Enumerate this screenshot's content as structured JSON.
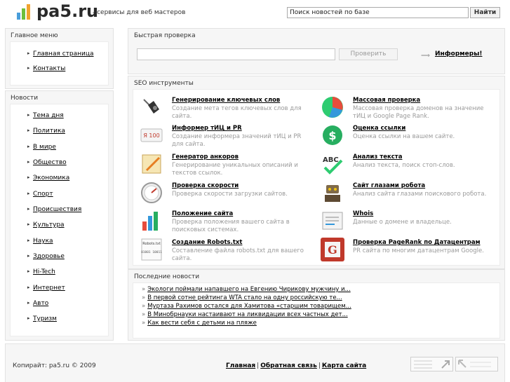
{
  "header": {
    "logo_text": "pa5.ru",
    "tagline": "- сервисы для веб мастеров",
    "search_value": "Поиск новостей по базе",
    "search_button": "Найти"
  },
  "main_menu": {
    "title": "Главное меню",
    "items": [
      "Главная страница",
      "Контакты"
    ]
  },
  "news_menu": {
    "title": "Новости",
    "items": [
      "Тема дня",
      "Политика",
      "В мире",
      "Общество",
      "Экономика",
      "Спорт",
      "Происшествия",
      "Культура",
      "Наука",
      "Здоровье",
      "Hi-Tech",
      "Интернет",
      "Авто",
      "Туризм"
    ]
  },
  "quick_check": {
    "title": "Быстрая проверка",
    "input_value": "",
    "button": "Проверить",
    "informers_link": "Информеры!"
  },
  "seo": {
    "title": "SEO инструменты",
    "tools": [
      {
        "title": "Генерирование ключевых слов",
        "desc": "Создание мета тегов ключевых слов для сайта.",
        "icon": "pushpin-icon"
      },
      {
        "title": "Массовая проверка",
        "desc": "Массовая проверка доменов на значение тИЦ и Google Page Rank.",
        "icon": "pie-chart-icon"
      },
      {
        "title": "Информер тИЦ и PR",
        "desc": "Создание информера значений тИЦ и PR для сайта.",
        "icon": "informer-badge-icon"
      },
      {
        "title": "Оценка ссылки",
        "desc": "Оценка ссылки на вашем сайте.",
        "icon": "dollar-icon"
      },
      {
        "title": "Генератор анкоров",
        "desc": "Генерирование уникальных описаний и текстов ссылок.",
        "icon": "notepad-pencil-icon"
      },
      {
        "title": "Анализ текста",
        "desc": "Анализ текста, поиск стоп-слов.",
        "icon": "abc-check-icon"
      },
      {
        "title": "Проверка скорости",
        "desc": "Проверка скорости загрузки сайтов.",
        "icon": "speedometer-icon"
      },
      {
        "title": "Сайт глазами робота",
        "desc": "Анализ сайта глазами поискового робота.",
        "icon": "robot-icon"
      },
      {
        "title": "Положение сайта",
        "desc": "Проверка положения вашего сайта в поисковых системах.",
        "icon": "bar-chart-icon"
      },
      {
        "title": "Whois",
        "desc": "Данные о домене и владельце.",
        "icon": "whois-card-icon"
      },
      {
        "title": "Создание Robots.txt",
        "desc": "Составление файла robots.txt для вашего сайта.",
        "icon": "robots-file-icon"
      },
      {
        "title": "Проверка PageRank по Датацентрам",
        "desc": "PR сайта по многим датацентрам Google.",
        "icon": "google-icon"
      }
    ],
    "icon_texts": {
      "informer": "Я 100",
      "abc": "ABC",
      "robots": "Robots.txt",
      "binary": "01001 10011",
      "google": "G"
    }
  },
  "latest_news": {
    "title": "Последние новости",
    "items": [
      "Экологи поймали напавшего на Евгению Чирикову мужчину и...",
      "В первой сотне рейтинга WTA стало на одну российскую те...",
      "Муртаза Рахимов остался для Хамитова «старшим товарищем...",
      "В Минобрнауки настаивают на ликвидации всех частных дет...",
      "Как вести себя с детьми на пляже"
    ]
  },
  "footer": {
    "copyright": "Копирайт: pa5.ru © 2009",
    "links": [
      "Главная",
      "Обратная связь",
      "Карта сайта"
    ],
    "separator": "|"
  },
  "colors": {
    "panel_bg": "#f6f6f6",
    "logo_bars": [
      "#4caf50",
      "#2196f3",
      "#f39c12",
      "#e74c3c"
    ]
  }
}
